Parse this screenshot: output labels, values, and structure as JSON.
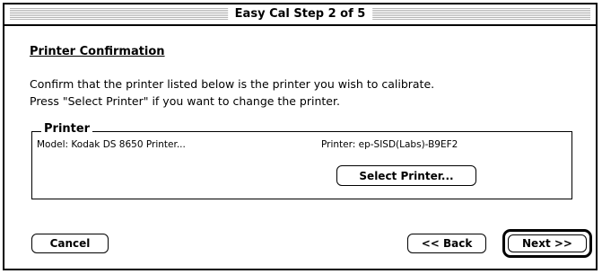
{
  "window": {
    "title": "Easy Cal Step 2 of 5"
  },
  "section": {
    "heading": "Printer Confirmation",
    "description_line1": "Confirm that the printer listed below is the printer you wish to calibrate.",
    "description_line2": "Press \"Select Printer\" if you want to change the printer."
  },
  "printer_group": {
    "legend": "Printer",
    "model": "Model: Kodak DS 8650 Printer...",
    "printer": "Printer: ep-SISD(Labs)-B9EF2",
    "select_button_label": "Select Printer..."
  },
  "footer": {
    "cancel_label": "Cancel",
    "back_label": "<< Back",
    "next_label": "Next >>"
  }
}
